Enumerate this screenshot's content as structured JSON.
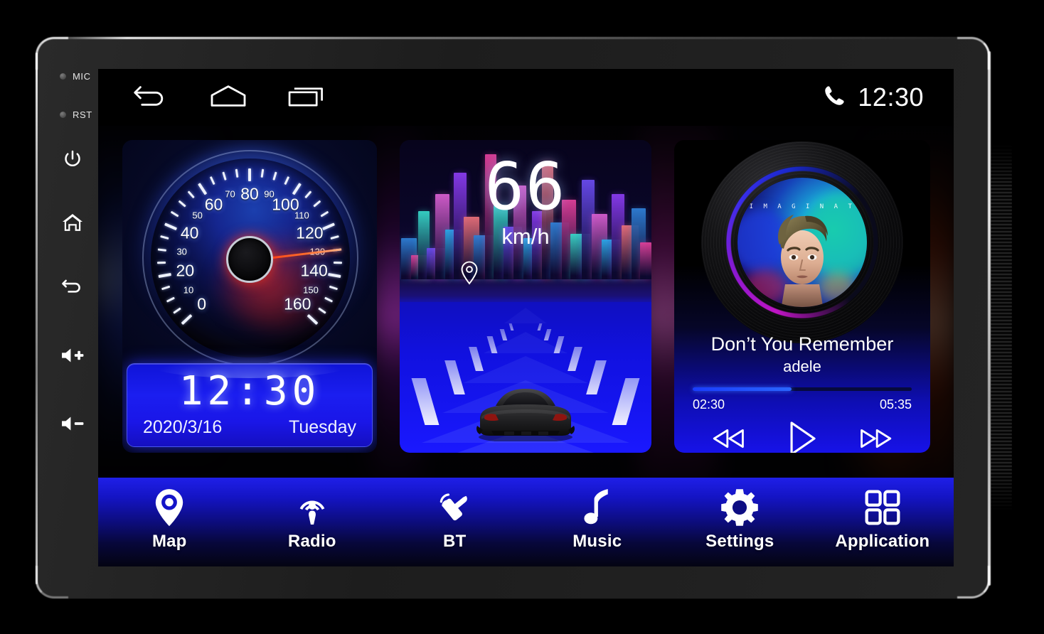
{
  "device": {
    "hardkeys": [
      {
        "name": "mic-indicator",
        "label": "MIC",
        "type": "led"
      },
      {
        "name": "reset-indicator",
        "label": "RST",
        "type": "led"
      },
      {
        "name": "power-button",
        "label": "",
        "icon": "power-icon"
      },
      {
        "name": "home-button",
        "label": "",
        "icon": "house-icon"
      },
      {
        "name": "back-button",
        "label": "",
        "icon": "return-arrow-icon"
      },
      {
        "name": "volume-up-button",
        "label": "",
        "icon": "speaker-plus-icon"
      },
      {
        "name": "volume-down-button",
        "label": "",
        "icon": "speaker-minus-icon"
      }
    ]
  },
  "statusbar": {
    "nav": [
      {
        "name": "nav-back",
        "icon": "back-arrow-icon"
      },
      {
        "name": "nav-home",
        "icon": "home-pentagon-icon"
      },
      {
        "name": "nav-recents",
        "icon": "recent-apps-icon"
      }
    ],
    "phone_icon": "phone-handset-icon",
    "clock": "12:30"
  },
  "speedometer": {
    "gauge": {
      "unit": "",
      "min": 0,
      "max": 160,
      "needle_value": 130,
      "major_labels": [
        "0",
        "20",
        "40",
        "60",
        "80",
        "100",
        "120",
        "140",
        "160"
      ],
      "minor_labels": [
        "10",
        "30",
        "50",
        "70",
        "90",
        "110",
        "130",
        "150"
      ]
    },
    "clock_card": {
      "time": "12:30",
      "date": "2020/3/16",
      "weekday": "Tuesday"
    }
  },
  "drive": {
    "speed_value": "66",
    "speed_unit": "km/h",
    "map_pin_icon": "location-pin-icon",
    "vehicle_icon": "car-rear-icon"
  },
  "music": {
    "album_word": "I M A G I N A T",
    "title": "Don’t You Remember",
    "artist": "adele",
    "elapsed": "02:30",
    "duration": "05:35",
    "progress_percent": 45,
    "controls": [
      {
        "name": "previous-track-button",
        "icon": "rewind-icon"
      },
      {
        "name": "play-button",
        "icon": "play-icon"
      },
      {
        "name": "next-track-button",
        "icon": "fast-forward-icon"
      }
    ]
  },
  "dock": {
    "items": [
      {
        "name": "dock-item-map",
        "label": "Map",
        "icon": "location-pin-icon"
      },
      {
        "name": "dock-item-radio",
        "label": "Radio",
        "icon": "radio-broadcast-icon"
      },
      {
        "name": "dock-item-bt",
        "label": "BT",
        "icon": "bluetooth-phone-icon"
      },
      {
        "name": "dock-item-music",
        "label": "Music",
        "icon": "music-note-icon"
      },
      {
        "name": "dock-item-settings",
        "label": "Settings",
        "icon": "gear-icon"
      },
      {
        "name": "dock-item-application",
        "label": "Application",
        "icon": "app-grid-icon"
      }
    ]
  },
  "colors": {
    "accent_blue": "#1a1ef0",
    "needle_red": "#ff3a12",
    "dock_blue": "#1f1fe8",
    "progress_blue": "#2a66ff"
  }
}
